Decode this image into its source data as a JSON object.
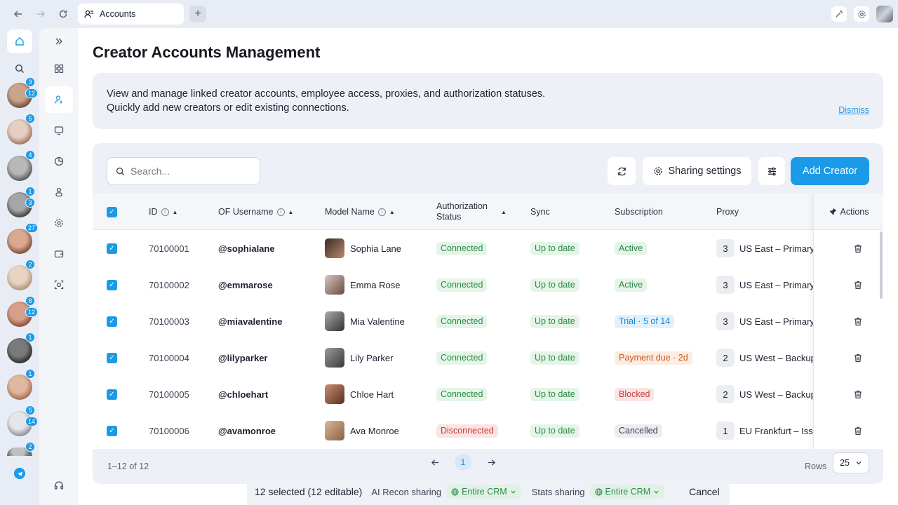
{
  "browser": {
    "tab_title": "Accounts",
    "new_tab_icon": "+"
  },
  "rail": {
    "avatars": [
      {
        "badges": [
          "3",
          "12"
        ],
        "colors": [
          "#c9a48a",
          "#6b4a3a"
        ]
      },
      {
        "badges": [
          "5"
        ],
        "colors": [
          "#e6cfc0",
          "#9a7060"
        ]
      },
      {
        "badges": [
          "4"
        ],
        "colors": [
          "#b8b8b8",
          "#555"
        ]
      },
      {
        "badges": [
          "1",
          "3"
        ],
        "colors": [
          "#a6a6a6",
          "#3c3c3c"
        ]
      },
      {
        "badges": [
          "27"
        ],
        "colors": [
          "#d9a890",
          "#7a4a34"
        ]
      },
      {
        "badges": [
          "2"
        ],
        "colors": [
          "#e8d4c4",
          "#b09070"
        ]
      },
      {
        "badges": [
          "8",
          "12"
        ],
        "colors": [
          "#d4a08a",
          "#8a4a3a"
        ]
      },
      {
        "badges": [
          "1"
        ],
        "colors": [
          "#7a7a7a",
          "#2a2a2a"
        ]
      },
      {
        "badges": [
          "1"
        ],
        "colors": [
          "#e0b8a0",
          "#a06a50"
        ]
      },
      {
        "badges": [
          "5",
          "14"
        ],
        "colors": [
          "#e6e6ea",
          "#8a8a92"
        ]
      },
      {
        "badges": [
          "2"
        ],
        "colors": [
          "#c0c0c0",
          "#707070"
        ]
      }
    ]
  },
  "page": {
    "title": "Creator Accounts Management",
    "info_line1": "View and manage linked creator accounts, employee access, proxies, and authorization statuses.",
    "info_line2": "Quickly add new creators or edit existing connections.",
    "dismiss": "Dismiss"
  },
  "toolbar": {
    "search_placeholder": "Search...",
    "sharing_settings": "Sharing settings",
    "add_creator": "Add Creator"
  },
  "table": {
    "columns": {
      "id": "ID",
      "of_username": "OF Username",
      "model_name": "Model Name",
      "auth_status_1": "Authorization",
      "auth_status_2": "Status",
      "sync": "Sync",
      "subscription": "Subscription",
      "proxy": "Proxy",
      "actions": "Actions"
    },
    "rows": [
      {
        "id": "70100001",
        "username": "@sophialane",
        "name": "Sophia Lane",
        "auth": "Connected",
        "auth_color": "green",
        "sync": "Up to date",
        "sub": "Active",
        "sub_color": "green",
        "proxy_n": "3",
        "proxy": "US East – Primary",
        "photo": [
          "#3a2a24",
          "#b88a70"
        ]
      },
      {
        "id": "70100002",
        "username": "@emmarose",
        "name": "Emma Rose",
        "auth": "Connected",
        "auth_color": "green",
        "sync": "Up to date",
        "sub": "Active",
        "sub_color": "green",
        "proxy_n": "3",
        "proxy": "US East – Primary",
        "photo": [
          "#d8c8c0",
          "#6a4a40"
        ]
      },
      {
        "id": "70100003",
        "username": "@miavalentine",
        "name": "Mia Valentine",
        "auth": "Connected",
        "auth_color": "green",
        "sync": "Up to date",
        "sub": "Trial · 5 of 14",
        "sub_color": "blue",
        "proxy_n": "3",
        "proxy": "US East – Primary",
        "photo": [
          "#aaaaaa",
          "#333333"
        ]
      },
      {
        "id": "70100004",
        "username": "@lilyparker",
        "name": "Lily Parker",
        "auth": "Connected",
        "auth_color": "green",
        "sync": "Up to date",
        "sub": "Payment due · 2d",
        "sub_color": "orange",
        "proxy_n": "2",
        "proxy": "US West – Backup",
        "photo": [
          "#9a9a9a",
          "#3a3a3a"
        ]
      },
      {
        "id": "70100005",
        "username": "@chloehart",
        "name": "Chloe Hart",
        "auth": "Connected",
        "auth_color": "green",
        "sync": "Up to date",
        "sub": "Blocked",
        "sub_color": "red",
        "proxy_n": "2",
        "proxy": "US West – Backup",
        "photo": [
          "#c89070",
          "#5a3020"
        ]
      },
      {
        "id": "70100006",
        "username": "@avamonroe",
        "name": "Ava Monroe",
        "auth": "Disconnected",
        "auth_color": "red",
        "sync": "Up to date",
        "sub": "Cancelled",
        "sub_color": "gray",
        "proxy_n": "1",
        "proxy": "EU Frankfurt – Issu",
        "photo": [
          "#d8b8a0",
          "#8a6040"
        ]
      }
    ]
  },
  "pagination": {
    "range": "1–12 of 12",
    "current_page": "1",
    "rows_label": "Rows",
    "rows_value": "25"
  },
  "selection_bar": {
    "count": "12 selected (12 editable)",
    "ai_recon_label": "AI Recon sharing",
    "ai_recon_value": "Entire CRM",
    "stats_label": "Stats sharing",
    "stats_value": "Entire CRM",
    "cancel": "Cancel"
  },
  "colors": {
    "accent": "#1b9ae8",
    "connected": "#2d8a45",
    "disconnected": "#c93838"
  }
}
